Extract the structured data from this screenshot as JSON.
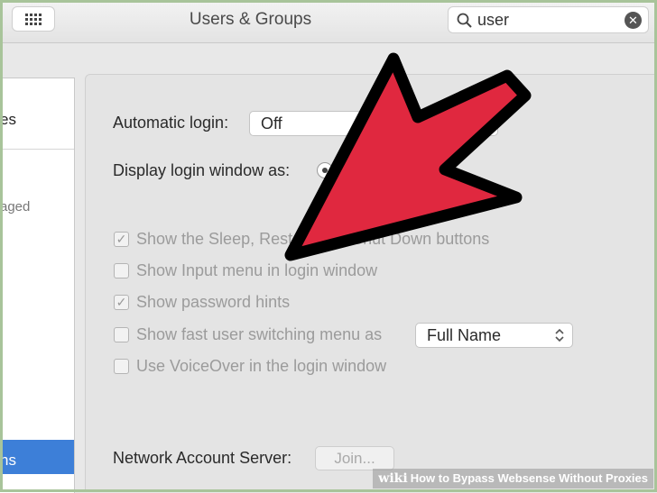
{
  "toolbar": {
    "title": "Users & Groups",
    "search_value": "user",
    "grid_icon": "grid-icon",
    "search_icon": "magnifier-icon",
    "clear_icon": "clear-icon"
  },
  "sidebar": {
    "item_top_partial": "es",
    "item_managed_partial": "aged",
    "item_selected_partial": "ns"
  },
  "main": {
    "automatic_login_label": "Automatic login:",
    "automatic_login_value": "Off",
    "display_login_label": "Display login window as:",
    "options": [
      {
        "label": "Show the Sleep, Restart, and Shut Down buttons",
        "checked": true
      },
      {
        "label": "Show Input menu in login window",
        "checked": false
      },
      {
        "label": "Show password hints",
        "checked": true
      },
      {
        "label": "Show fast user switching menu as",
        "checked": false
      },
      {
        "label": "Use VoiceOver in the login window",
        "checked": false
      }
    ],
    "fast_user_switching_value": "Full Name",
    "network_account_label": "Network Account Server:",
    "join_button": "Join..."
  },
  "overlay": {
    "arrow_color": "#e0283f"
  },
  "watermark": {
    "brand": "wiki",
    "title": "How to Bypass Websense Without Proxies"
  }
}
